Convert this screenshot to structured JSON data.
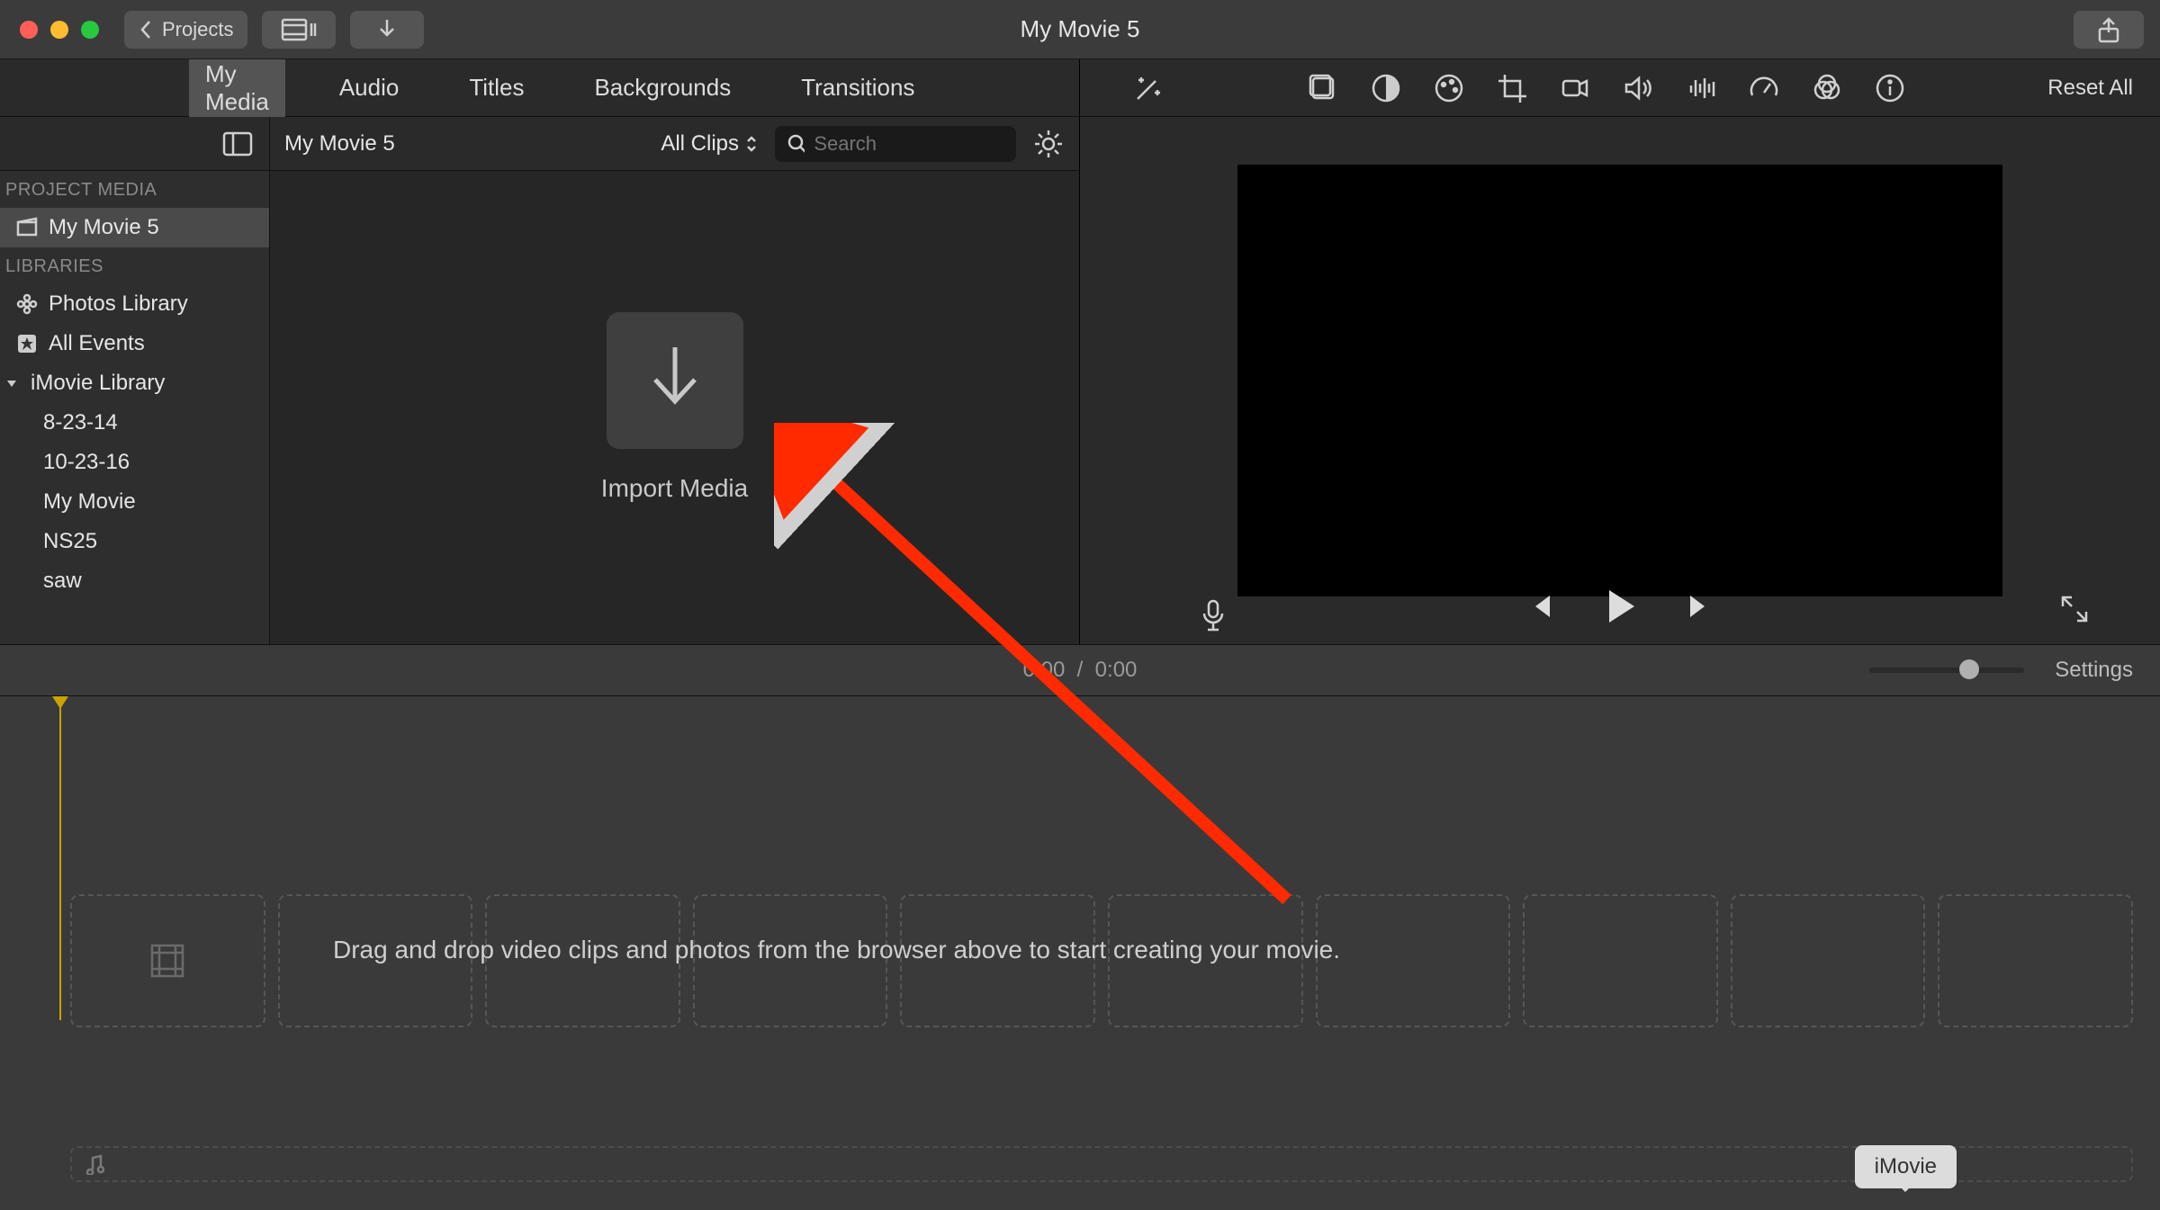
{
  "titlebar": {
    "title": "My Movie 5",
    "projects_label": "Projects"
  },
  "tabs": [
    "My Media",
    "Audio",
    "Titles",
    "Backgrounds",
    "Transitions"
  ],
  "active_tab": 0,
  "browser": {
    "project_name": "My Movie 5",
    "filter_label": "All Clips",
    "search_placeholder": "Search",
    "import_label": "Import Media"
  },
  "sidebar": {
    "section_project": "PROJECT MEDIA",
    "project_item": "My Movie 5",
    "section_libraries": "LIBRARIES",
    "photos_library": "Photos Library",
    "all_events": "All Events",
    "imovie_library": "iMovie Library",
    "events": [
      "8-23-14",
      "10-23-16",
      "My Movie",
      "NS25",
      "saw"
    ]
  },
  "inspector": {
    "reset_label": "Reset All"
  },
  "time_header": {
    "current": "0:00",
    "separator": "/",
    "total": "0:00",
    "settings_label": "Settings"
  },
  "timeline": {
    "drag_drop_text": "Drag and drop video clips and photos from the browser above to start creating your movie."
  },
  "tooltip": {
    "text": "iMovie"
  }
}
